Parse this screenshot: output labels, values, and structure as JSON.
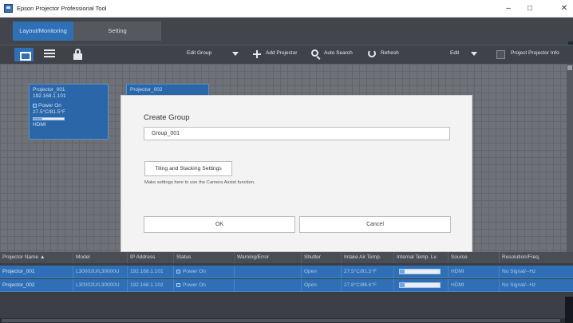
{
  "window": {
    "title": "Epson Projector Professional Tool",
    "controls": {
      "minimize": "–",
      "maximize": "□",
      "close": "✕"
    }
  },
  "tabs": [
    {
      "label": "Layout/Monitoring",
      "active": true
    },
    {
      "label": "Setting",
      "active": false
    }
  ],
  "toolbar": {
    "edit_group": "Edit Group",
    "add_projector": "Add Projector",
    "auto_search": "Auto Search",
    "refresh": "Refresh",
    "edit": "Edit",
    "project_projector_info": "Project Projector Info",
    "icons": [
      "grid-view-icon",
      "list-view-icon",
      "lock-icon",
      "chevron-down-icon",
      "plus-icon",
      "search-icon",
      "refresh-icon",
      "chevron-down-icon"
    ]
  },
  "cards": [
    {
      "name": "Projector_001",
      "ip": "192.168.1.101",
      "power": "Power On",
      "temp": "27.5°C/81.5°F",
      "source": "HDMI"
    },
    {
      "name": "Projector_002",
      "ip": "",
      "power": "",
      "temp": "",
      "source": ""
    }
  ],
  "table": {
    "headers": [
      "Projector Name ▲",
      "Model",
      "IP Address",
      "Status",
      "Warning/Error",
      "Shutter",
      "Intake Air Temp.",
      "Internal Temp. Lv.",
      "Source",
      "Resolution/Freq."
    ],
    "rows": [
      {
        "name": "Projector_001",
        "model": "L30002U/L30000U",
        "ip": "192.168.1.101",
        "status": "Power On",
        "warning": "",
        "shutter": "Open",
        "intake": "27.5°C/81.5°F",
        "internal_level": 0.12,
        "source": "HDMI",
        "resolution": "No Signal/--Hz"
      },
      {
        "name": "Projector_002",
        "model": "L30002U/L30000U",
        "ip": "192.168.1.102",
        "status": "Power On",
        "warning": "",
        "shutter": "Open",
        "intake": "27.8°C/86.6°F",
        "internal_level": 0.12,
        "source": "HDMI",
        "resolution": "No Signal/--Hz"
      }
    ]
  },
  "dialog": {
    "title": "Create Group",
    "group_name": "Group_001",
    "tiling_button": "Tiling and Stacking Settings",
    "note": "Make settings here to use the Camera Assist function.",
    "ok": "OK",
    "cancel": "Cancel"
  },
  "colors": {
    "accent": "#2f6fb6",
    "background": "#3c4046"
  }
}
